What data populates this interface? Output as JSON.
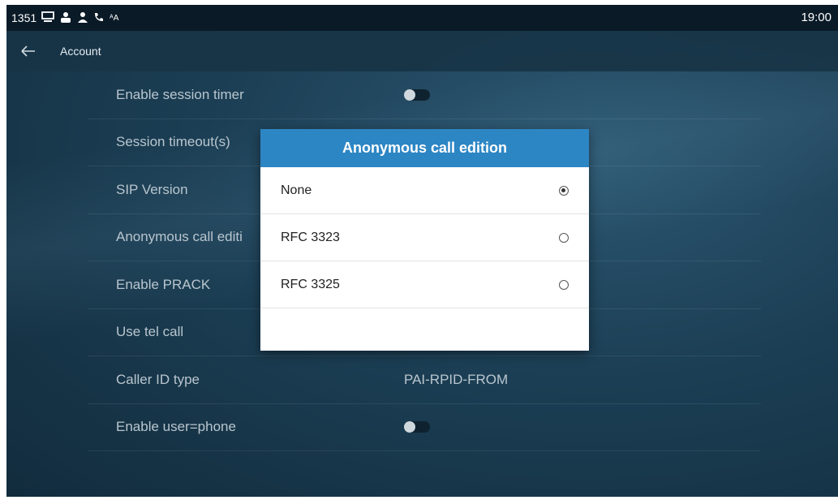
{
  "statusbar": {
    "left_text": "1351",
    "icons": [
      "monitor-icon",
      "contacts-icon",
      "user-icon",
      "call-forward-icon",
      "translate-icon"
    ],
    "time": "19:00"
  },
  "titlebar": {
    "title": "Account"
  },
  "settings": {
    "rows": [
      {
        "label": "Enable session timer",
        "type": "toggle",
        "on": false
      },
      {
        "label": "Session timeout(s)",
        "type": "text",
        "value": ""
      },
      {
        "label": "SIP Version",
        "type": "text",
        "value": ""
      },
      {
        "label": "Anonymous call editi",
        "type": "text",
        "value": ""
      },
      {
        "label": "Enable PRACK",
        "type": "text",
        "value": ""
      },
      {
        "label": "Use tel call",
        "type": "toggle",
        "on": false
      },
      {
        "label": "Caller ID type",
        "type": "text",
        "value": "PAI-RPID-FROM"
      },
      {
        "label": "Enable user=phone",
        "type": "toggle",
        "on": false
      }
    ]
  },
  "dialog": {
    "title": "Anonymous call edition",
    "options": [
      {
        "label": "None",
        "selected": true
      },
      {
        "label": "RFC 3323",
        "selected": false
      },
      {
        "label": "RFC 3325",
        "selected": false
      }
    ]
  },
  "colors": {
    "accent": "#2d86c4",
    "statusbar": "#0a1a27",
    "background": "#1c3f55"
  }
}
